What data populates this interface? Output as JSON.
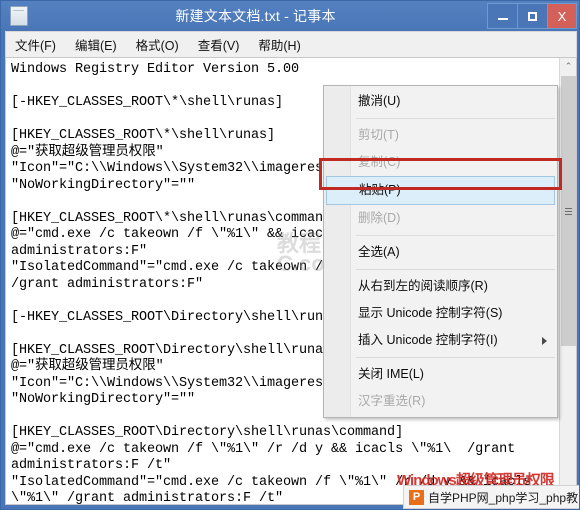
{
  "window": {
    "title": "新建文本文档.txt - 记事本",
    "app_icon": "notepad-icon",
    "buttons": {
      "minimize": "–",
      "maximize": "□",
      "close": "X"
    },
    "colors": {
      "titlebar": "#4a76b8",
      "close_button": "#d4605a",
      "annotation": "#c02a23",
      "menu_highlight": "#ddeefb"
    }
  },
  "menubar": {
    "items": [
      {
        "label": "文件(F)"
      },
      {
        "label": "编辑(E)"
      },
      {
        "label": "格式(O)"
      },
      {
        "label": "查看(V)"
      },
      {
        "label": "帮助(H)"
      }
    ]
  },
  "editor": {
    "content": "Windows Registry Editor Version 5.00\n\n[-HKEY_CLASSES_ROOT\\*\\shell\\runas]\n\n[HKEY_CLASSES_ROOT\\*\\shell\\runas]\n@=\"获取超级管理员权限\"\n\"Icon\"=\"C:\\\\Windows\\\\System32\\\\imageres.dll,-78\"\n\"NoWorkingDirectory\"=\"\"\n\n[HKEY_CLASSES_ROOT\\*\\shell\\runas\\command]\n@=\"cmd.exe /c takeown /f \\\"%1\\\" && icacls \\\"%1\\\" /grant\nadministrators:F\"\n\"IsolatedCommand\"=\"cmd.exe /c takeown /f \\\"%1\\\" && icacls \\\"%1\\\"\n/grant administrators:F\"\n\n[-HKEY_CLASSES_ROOT\\Directory\\shell\\runas]\n\n[HKEY_CLASSES_ROOT\\Directory\\shell\\runas]\n@=\"获取超级管理员权限\"\n\"Icon\"=\"C:\\\\Windows\\\\System32\\\\imageres.dll,-78\"\n\"NoWorkingDirectory\"=\"\"\n\n[HKEY_CLASSES_ROOT\\Directory\\shell\\runas\\command]\n@=\"cmd.exe /c takeown /f \\\"%1\\\" /r /d y && icacls \\\"%1\\  /grant\nadministrators:F /t\"\n\"IsolatedCommand\"=\"cmd.exe /c takeown /f \\\"%1\\\" /r /d y && icacls\n\\\"%1\\\" /grant administrators:F /t\""
  },
  "scrollbar": {
    "up_arrow": "⌃",
    "down_arrow": "⌄"
  },
  "context_menu": {
    "items": [
      {
        "label": "撤消(U)",
        "disabled": false,
        "highlighted": false,
        "submenu": false,
        "separator_after": true
      },
      {
        "label": "剪切(T)",
        "disabled": true,
        "highlighted": false,
        "submenu": false,
        "separator_after": false
      },
      {
        "label": "复制(C)",
        "disabled": true,
        "highlighted": false,
        "submenu": false,
        "separator_after": false
      },
      {
        "label": "粘贴(P)",
        "disabled": false,
        "highlighted": true,
        "submenu": false,
        "separator_after": false
      },
      {
        "label": "删除(D)",
        "disabled": true,
        "highlighted": false,
        "submenu": false,
        "separator_after": true
      },
      {
        "label": "全选(A)",
        "disabled": false,
        "highlighted": false,
        "submenu": false,
        "separator_after": true
      },
      {
        "label": "从右到左的阅读顺序(R)",
        "disabled": false,
        "highlighted": false,
        "submenu": false,
        "separator_after": false
      },
      {
        "label": "显示 Unicode 控制字符(S)",
        "disabled": false,
        "highlighted": false,
        "submenu": false,
        "separator_after": false
      },
      {
        "label": "插入 Unicode 控制字符(I)",
        "disabled": false,
        "highlighted": false,
        "submenu": true,
        "separator_after": true
      },
      {
        "label": "关闭 IME(L)",
        "disabled": false,
        "highlighted": false,
        "submenu": false,
        "separator_after": false
      },
      {
        "label": "汉字重选(R)",
        "disabled": true,
        "highlighted": false,
        "submenu": false,
        "separator_after": false
      }
    ]
  },
  "watermarks": {
    "center": "教程\nC.com",
    "red_text": "Windows超级管理员权限",
    "bar_icon": "P",
    "bar_text": "自学PHP网_php学习_php教"
  }
}
